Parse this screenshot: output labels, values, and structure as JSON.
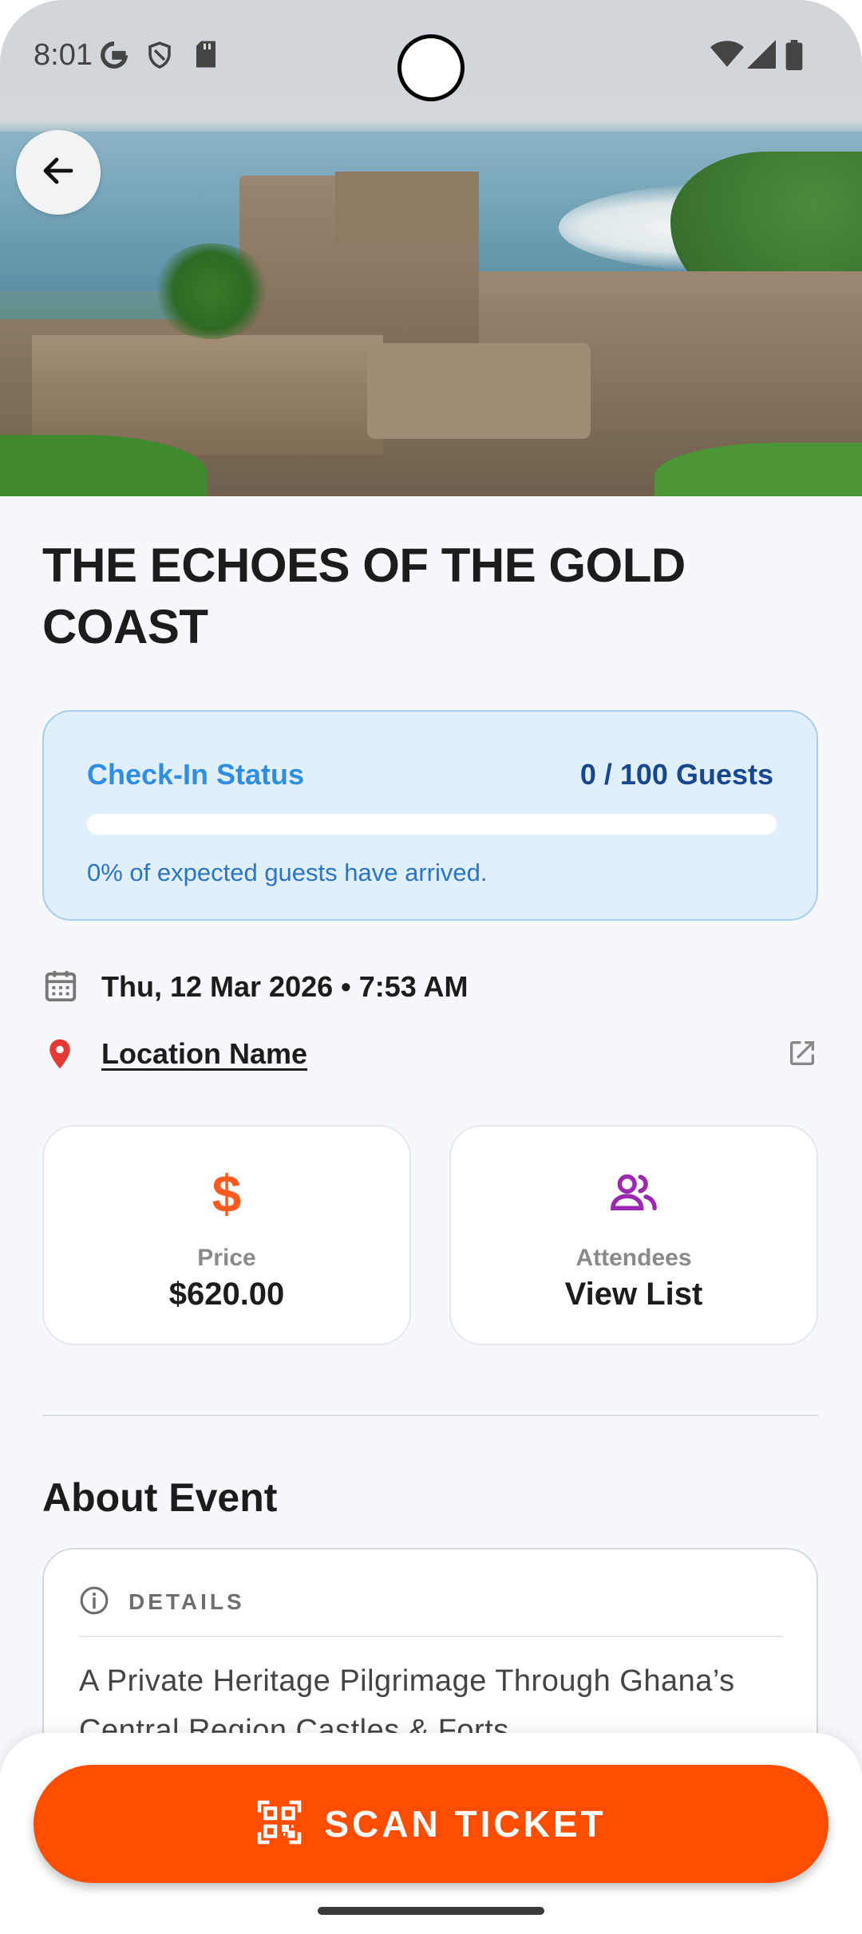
{
  "status_bar": {
    "time": "8:01"
  },
  "event": {
    "title": "THE ECHOES OF THE GOLD COAST",
    "date_time": "Thu, 12 Mar 2026 • 7:53 AM",
    "location": "Location Name"
  },
  "checkin": {
    "label": "Check-In Status",
    "count": "0 / 100 Guests",
    "progress_percent": 0,
    "message": "0% of expected guests have arrived."
  },
  "cards": {
    "price": {
      "label": "Price",
      "value": "$620.00"
    },
    "attendees": {
      "label": "Attendees",
      "value": "View List"
    }
  },
  "about": {
    "title": "About Event",
    "details_label": "DETAILS",
    "text": "A Private Heritage Pilgrimage Through Ghana’s Central Region Castles & Forts"
  },
  "scan_button": {
    "label": "SCAN TICKET"
  },
  "colors": {
    "accent": "#ff4d00",
    "checkin_blue": "#2f8ee0",
    "price_icon": "#ff5a1f",
    "attendees_icon": "#9c27b0",
    "location_pin": "#e53935"
  }
}
